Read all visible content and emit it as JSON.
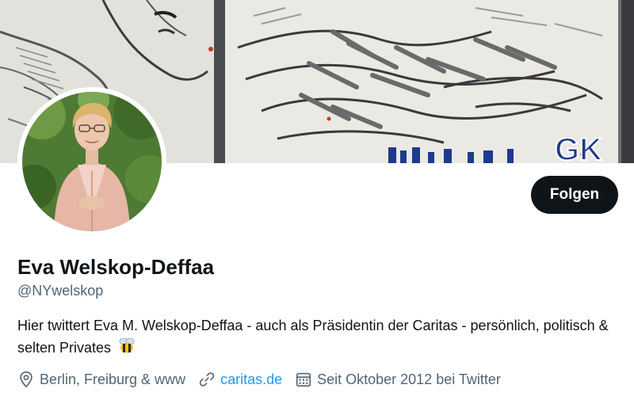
{
  "profile": {
    "name": "Eva Welskop-Deffaa",
    "handle": "@NYwelskop",
    "follow_label": "Folgen",
    "bio": "Hier twittert Eva M. Welskop-Deffaa - auch als Präsidentin der Caritas - persönlich, politisch & selten Privates",
    "bio_emoji": "bee-emoji"
  },
  "meta": {
    "location": "Berlin, Freiburg & www",
    "location_icon": "location-pin-icon",
    "website": "caritas.de",
    "website_icon": "link-icon",
    "joined": "Seit Oktober 2012 bei Twitter",
    "joined_icon": "calendar-icon"
  },
  "banner": {
    "description_icon": "mural-graffiti-image",
    "graffiti_text": "GK"
  },
  "colors": {
    "follow_button_bg": "#0f1419",
    "follow_button_text": "#ffffff",
    "link": "#1d9bf0",
    "secondary_text": "#536471",
    "primary_text": "#0f1419"
  }
}
